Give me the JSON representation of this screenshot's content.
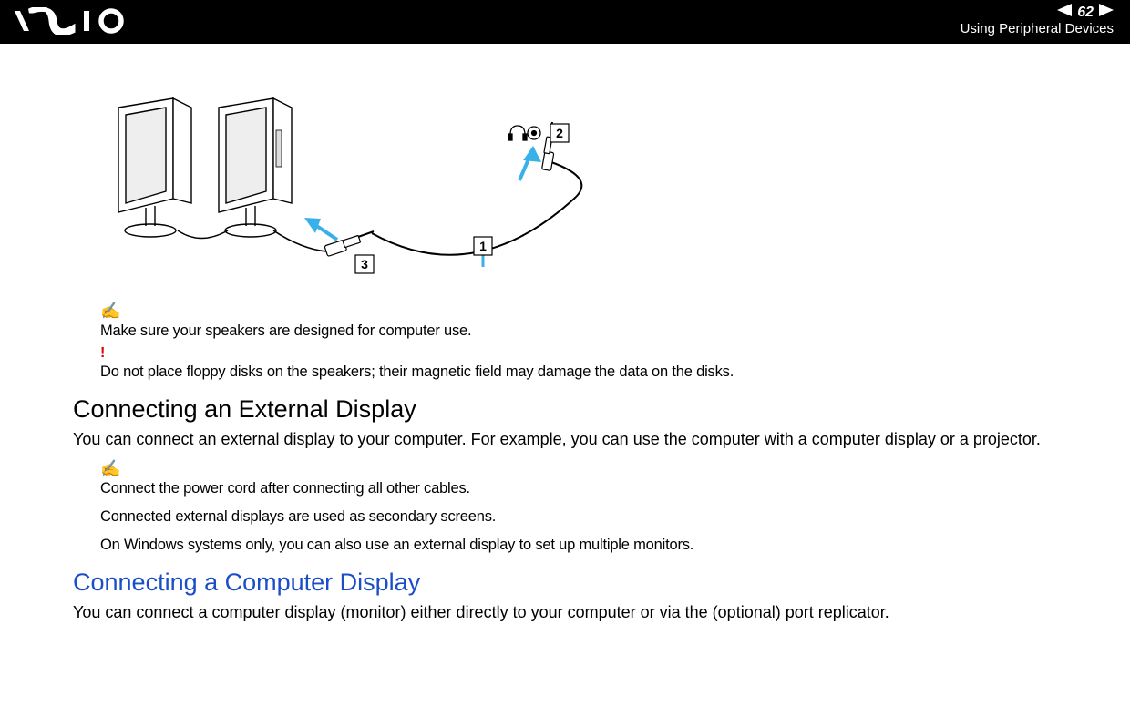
{
  "header": {
    "page_number": "62",
    "section_title": "Using Peripheral Devices"
  },
  "diagram": {
    "callouts": {
      "c1": "1",
      "c2": "2",
      "c3": "3"
    }
  },
  "notes": {
    "speaker_note": "Make sure your speakers are designed for computer use.",
    "floppy_warning": "Do not place floppy disks on the speakers; their magnetic field may damage the data on the disks."
  },
  "section1": {
    "heading": "Connecting an External Display",
    "body": "You can connect an external display to your computer. For example, you can use the computer with a computer display or a projector.",
    "tip1": "Connect the power cord after connecting all other cables.",
    "tip2": "Connected external displays are used as secondary screens.",
    "tip3": "On Windows systems only, you can also use an external display to set up multiple monitors."
  },
  "section2": {
    "heading": "Connecting a Computer Display",
    "body": "You can connect a computer display (monitor) either directly to your computer or via the (optional) port replicator."
  }
}
